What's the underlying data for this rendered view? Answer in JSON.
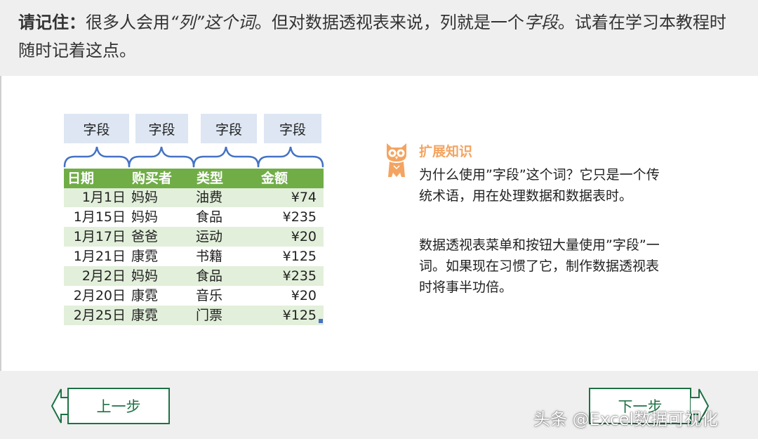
{
  "banner": {
    "label": "请记住：",
    "text1": "很多人会用",
    "quoted1": "“列”这个词",
    "text2": "。但对数据透视表来说，列就是一个",
    "quoted2": "字段",
    "text3": "。试着在学习本教程时随时记着这点。"
  },
  "fields": [
    "字段",
    "字段",
    "字段",
    "字段"
  ],
  "table": {
    "headers": [
      "日期",
      "购买者",
      "类型",
      "金额"
    ],
    "rows": [
      [
        "1月1日",
        "妈妈",
        "油费",
        "¥74"
      ],
      [
        "1月15日",
        "妈妈",
        "食品",
        "¥235"
      ],
      [
        "1月17日",
        "爸爸",
        "运动",
        "¥20"
      ],
      [
        "1月21日",
        "康霓",
        "书籍",
        "¥125"
      ],
      [
        "2月2日",
        "妈妈",
        "食品",
        "¥235"
      ],
      [
        "2月20日",
        "康霓",
        "音乐",
        "¥20"
      ],
      [
        "2月25日",
        "康霓",
        "门票",
        "¥125"
      ]
    ]
  },
  "tip": {
    "title": "扩展知识",
    "para1": "为什么使用”字段”这个词？它只是一个传统术语，用在处理数据和数据表时。",
    "para2": "数据透视表菜单和按钮大量使用”字段”一词。如果现在习惯了它，制作数据透视表时将事半功倍。"
  },
  "nav": {
    "prev": "上一步",
    "next": "下一步"
  },
  "watermark": "头条 @Excel数据可视化",
  "colors": {
    "accent": "#1e7145",
    "header_green": "#70ad47",
    "band": "#e2efda",
    "field_box": "#dde6f2",
    "brace": "#4472c4",
    "tip_orange": "#f4a460"
  },
  "icons": {
    "tip": "owl-icon",
    "prev": "arrow-left-icon",
    "next": "arrow-right-icon"
  }
}
